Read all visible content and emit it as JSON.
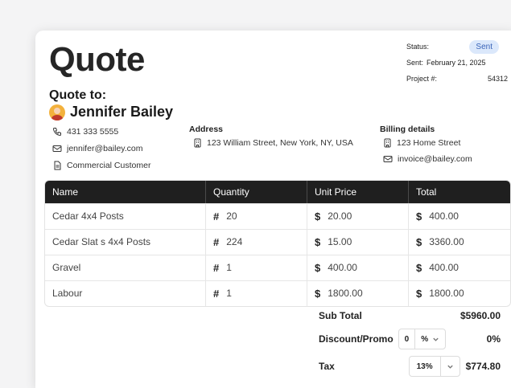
{
  "quote": {
    "title": "Quote",
    "status_label": "Status:",
    "status_value": "Sent",
    "sent_label": "Sent:",
    "sent_value": "February 21, 2025",
    "project_label": "Project #:",
    "project_value": "54312"
  },
  "client": {
    "heading": "Quote to:",
    "name": "Jennifer Bailey",
    "phone": "431 333 5555",
    "email": "jennifer@bailey.com",
    "type": "Commercial Customer"
  },
  "address": {
    "heading": "Address",
    "value": "123 William Street, New York, NY, USA"
  },
  "billing": {
    "heading": "Billing details",
    "address": "123 Home Street",
    "email": "invoice@bailey.com"
  },
  "table": {
    "headers": [
      "Name",
      "Quantity",
      "Unit Price",
      "Total"
    ],
    "rows": [
      {
        "name": "Cedar 4x4 Posts",
        "qty": "20",
        "price": "20.00",
        "total": "400.00"
      },
      {
        "name": "Cedar Slat s 4x4 Posts",
        "qty": "224",
        "price": "15.00",
        "total": "3360.00"
      },
      {
        "name": "Gravel",
        "qty": "1",
        "price": "400.00",
        "total": "400.00"
      },
      {
        "name": "Labour",
        "qty": "1",
        "price": "1800.00",
        "total": "1800.00"
      }
    ],
    "qty_symbol": "#",
    "currency_symbol": "$"
  },
  "totals": {
    "subtotal_label": "Sub Total",
    "subtotal_value": "$5960.00",
    "discount_label": "Discount/Promo",
    "discount_amount": "0",
    "discount_unit": "%",
    "discount_value": "0%",
    "tax_label": "Tax",
    "tax_rate": "13%",
    "tax_value": "$774.80"
  },
  "icons": {
    "phone": "phone-icon",
    "email": "mail-icon",
    "document": "document-icon",
    "building": "building-icon",
    "chevron": "chevron-down-icon"
  },
  "colors": {
    "header_bg": "#1f1f1f",
    "badge_bg": "#dbe8fb",
    "badge_text": "#3a64b8"
  }
}
